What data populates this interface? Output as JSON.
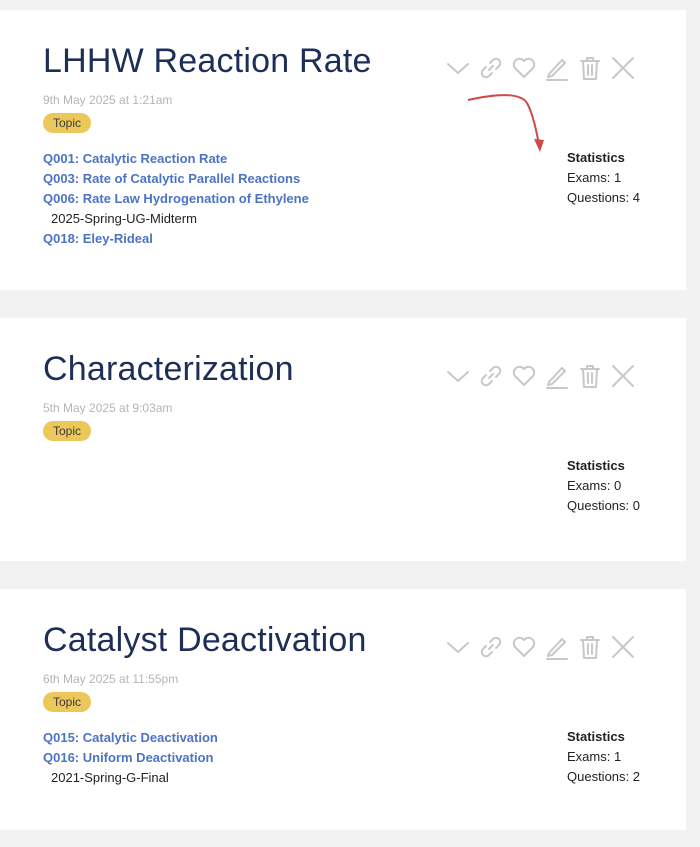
{
  "cards": [
    {
      "title": "LHHW Reaction Rate",
      "date": "9th May 2025 at 1:21am",
      "badge": "Topic",
      "questions": [
        {
          "label": "Q001: Catalytic Reaction Rate",
          "exam": ""
        },
        {
          "label": "Q003: Rate of Catalytic Parallel Reactions",
          "exam": ""
        },
        {
          "label": "Q006: Rate Law Hydrogenation of Ethylene",
          "exam": "2025-Spring-UG-Midterm"
        },
        {
          "label": "Q018: Eley-Rideal",
          "exam": ""
        }
      ],
      "stats": {
        "heading": "Statistics",
        "exams": "Exams: 1",
        "questions": "Questions: 4"
      }
    },
    {
      "title": "Characterization",
      "date": "5th May 2025 at 9:03am",
      "badge": "Topic",
      "questions": [],
      "stats": {
        "heading": "Statistics",
        "exams": "Exams: 0",
        "questions": "Questions: 0"
      }
    },
    {
      "title": "Catalyst Deactivation",
      "date": "6th May 2025 at 11:55pm",
      "badge": "Topic",
      "questions": [
        {
          "label": "Q015: Catalytic Deactivation",
          "exam": ""
        },
        {
          "label": "Q016: Uniform Deactivation",
          "exam": "2021-Spring-G-Final"
        }
      ],
      "stats": {
        "heading": "Statistics",
        "exams": "Exams: 1",
        "questions": "Questions: 2"
      }
    }
  ],
  "action_icons": [
    "chevron-down-icon",
    "link-icon",
    "heart-icon",
    "pencil-icon",
    "trash-icon",
    "close-icon"
  ],
  "colors": {
    "title": "#1e2f57",
    "link": "#4c73c4",
    "badge": "#ecc85a",
    "icon": "#c8c8c8",
    "annotation_arrow": "#d04848",
    "background": "#f2f2f2"
  }
}
